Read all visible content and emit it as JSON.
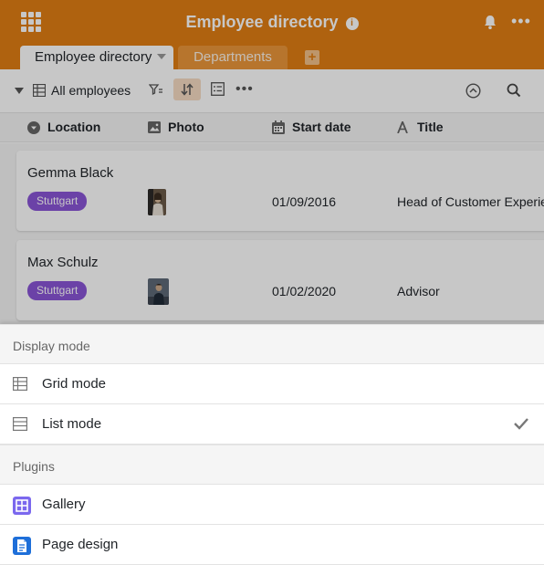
{
  "app": {
    "title": "Employee directory",
    "tabs": [
      {
        "label": "Employee directory",
        "active": true
      },
      {
        "label": "Departments",
        "active": false
      }
    ],
    "accent_color": "#e07e14"
  },
  "toolbar": {
    "view_label": "All employees"
  },
  "columns": [
    {
      "label": "Location",
      "icon": "single-select-icon"
    },
    {
      "label": "Photo",
      "icon": "image-icon"
    },
    {
      "label": "Start date",
      "icon": "calendar-icon"
    },
    {
      "label": "Title",
      "icon": "text-icon"
    }
  ],
  "rows": [
    {
      "name": "Gemma Black",
      "location": "Stuttgart",
      "start_date": "01/09/2016",
      "title": "Head of Customer Experie"
    },
    {
      "name": "Max Schulz",
      "location": "Stuttgart",
      "start_date": "01/02/2020",
      "title": "Advisor"
    }
  ],
  "sheet": {
    "display_mode_label": "Display mode",
    "modes": [
      {
        "label": "Grid mode",
        "icon": "grid-mode-icon",
        "checked": false
      },
      {
        "label": "List mode",
        "icon": "list-mode-icon",
        "checked": true
      }
    ],
    "plugins_label": "Plugins",
    "plugins": [
      {
        "label": "Gallery",
        "icon": "gallery-icon",
        "color": "#7b68ee"
      },
      {
        "label": "Page design",
        "icon": "page-design-icon",
        "color": "#1e6fd9"
      }
    ]
  }
}
